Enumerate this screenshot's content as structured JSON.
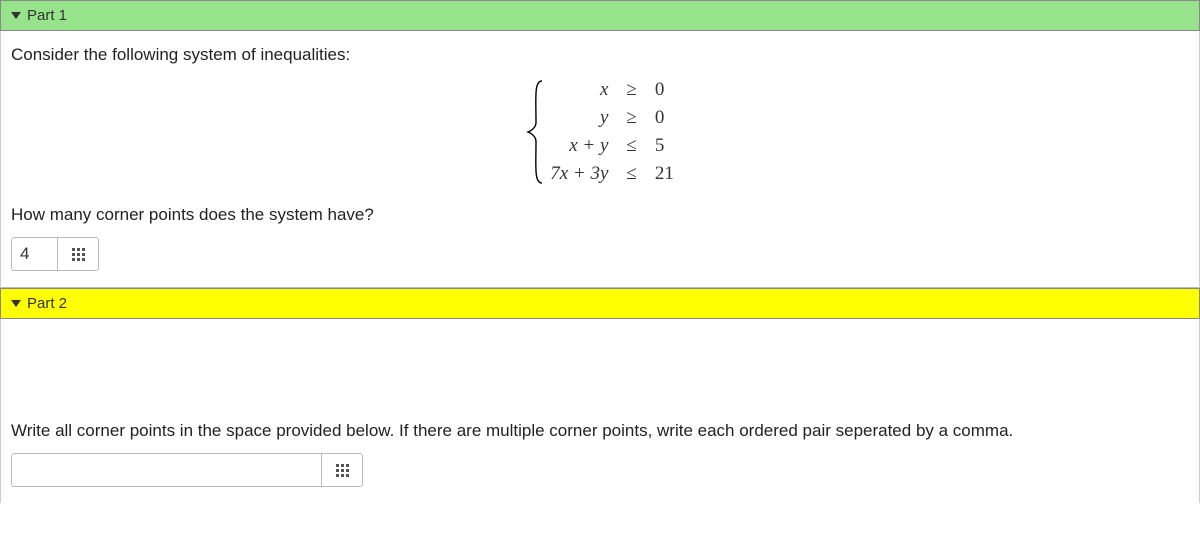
{
  "part1": {
    "header": "Part 1",
    "prompt": "Consider the following system of inequalities:",
    "system": {
      "rows": [
        {
          "lhs": "x",
          "op": "≥",
          "rhs": "0"
        },
        {
          "lhs": "y",
          "op": "≥",
          "rhs": "0"
        },
        {
          "lhs": "x + y",
          "op": "≤",
          "rhs": "5"
        },
        {
          "lhs": "7x + 3y",
          "op": "≤",
          "rhs": "21"
        }
      ]
    },
    "question": "How many corner points does the system have?",
    "answer_value": "4"
  },
  "part2": {
    "header": "Part 2",
    "question": "Write all corner points in the space provided below. If there are multiple corner points, write each ordered pair seperated by a comma.",
    "answer_value": ""
  }
}
